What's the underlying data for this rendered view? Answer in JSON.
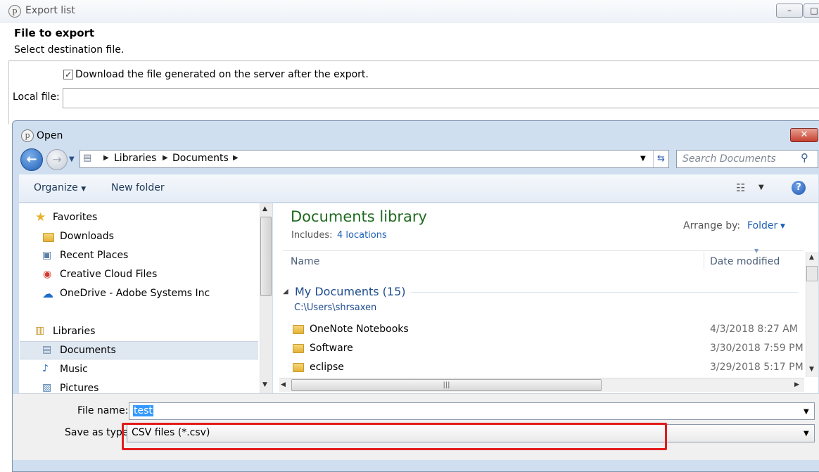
{
  "parent_window": {
    "title": "Export list",
    "min_label": "–",
    "header_title": "File to export",
    "header_subtitle": "Select destination file.",
    "download_checkbox_label": "Download the file generated on the server after the export.",
    "download_checked": true,
    "local_file_label": "Local file:",
    "local_file_value": ""
  },
  "open_dialog": {
    "title": "Open",
    "close_label": "✕",
    "breadcrumb": [
      "Libraries",
      "Documents"
    ],
    "search_placeholder": "Search Documents",
    "toolbar": {
      "organize": "Organize",
      "new_folder": "New folder"
    },
    "nav": {
      "favorites": "Favorites",
      "favorites_items": [
        "Downloads",
        "Recent Places",
        "Creative Cloud Files",
        "OneDrive - Adobe Systems Inc"
      ],
      "libraries": "Libraries",
      "libraries_items": [
        "Documents",
        "Music",
        "Pictures"
      ],
      "selected": "Documents"
    },
    "content": {
      "title": "Documents library",
      "includes_label": "Includes:",
      "includes_link": "4 locations",
      "arrange_label": "Arrange by:",
      "arrange_value": "Folder",
      "columns": [
        "Name",
        "Date modified"
      ],
      "group_title": "My Documents (15)",
      "group_path": "C:\\Users\\shrsaxen",
      "files": [
        {
          "name": "OneNote Notebooks",
          "date": "4/3/2018 8:27 AM"
        },
        {
          "name": "Software",
          "date": "3/30/2018 7:59 PM"
        },
        {
          "name": "eclipse",
          "date": "3/29/2018 5:17 PM"
        }
      ]
    },
    "form": {
      "filename_label": "File name:",
      "filename_value": "test",
      "savetype_label": "Save as type:",
      "savetype_value": "CSV files (*.csv)"
    },
    "colors": {
      "highlight": "#e31b1b",
      "library_title": "#1e6a1e",
      "link": "#1e5fb6"
    }
  }
}
